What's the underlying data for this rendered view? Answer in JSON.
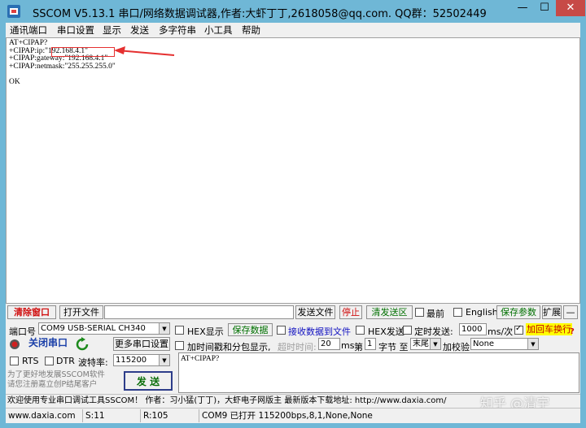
{
  "window": {
    "title": "SSCOM V5.13.1 串口/网络数据调试器,作者:大虾丁丁,2618058@qq.com. QQ群：52502449",
    "min": "—",
    "max": "☐",
    "close": "✕"
  },
  "menu": [
    "通讯端口",
    "串口设置",
    "显示",
    "发送",
    "多字符串",
    "小工具",
    "帮助"
  ],
  "output": {
    "lines": [
      "AT+CIPAP?",
      "+CIPAP:ip:\"192.168.4.1\"",
      "+CIPAP:gateway:\"192.168.4.1\"",
      "+CIPAP:netmask:\"255.255.255.0\"",
      "",
      "OK"
    ]
  },
  "toolbar": {
    "clear_window": "清除窗口",
    "open_file": "打开文件",
    "file_path": "",
    "send_file": "发送文件",
    "stop": "停止",
    "clear_send": "清发送区",
    "topmost": "最前",
    "english": "English",
    "save_params": "保存参数",
    "expand": "扩展",
    "collapse": "—"
  },
  "port": {
    "port_label": "端口号",
    "port_value": "COM9 USB-SERIAL CH340",
    "close_port": "关闭串口",
    "more_settings": "更多串口设置",
    "rts": "RTS",
    "dtr": "DTR",
    "baud_label": "波特率:",
    "baud_value": "115200"
  },
  "options": {
    "hex_display": "HEX显示",
    "save_data": "保存数据",
    "recv_to_file": "接收数据到文件",
    "hex_send": "HEX发送",
    "timed_send": "定时发送:",
    "interval": "1000",
    "interval_unit": "ms/次",
    "add_crlf": "加回车换行",
    "timestamp": "加时间戳和分包显示,",
    "timeout_label": "超时时间:",
    "timeout_value": "20",
    "timeout_unit": "ms",
    "byte_prefix": "第",
    "byte_index": "1",
    "byte_unit": "字节 至",
    "byte_end": "末尾",
    "checksum_label": "加校验",
    "checksum_value": "None"
  },
  "send": {
    "text": "AT+CIPAP?",
    "button": "发 送",
    "promo": "为了更好地发展SSCOM软件\n请您注册嘉立创P结尾客户"
  },
  "ticker": "欢迎使用专业串口调试工具SSCOM！   作者：习小猛(丁丁)，大虾电子网版主   最新版本下载地址: http://www.daxia.com/",
  "status": {
    "website": "www.daxia.com",
    "sent": "S:11",
    "received": "R:105",
    "port_state": "COM9 已打开  115200bps,8,1,None,None"
  },
  "watermark": "知乎 @清宇"
}
